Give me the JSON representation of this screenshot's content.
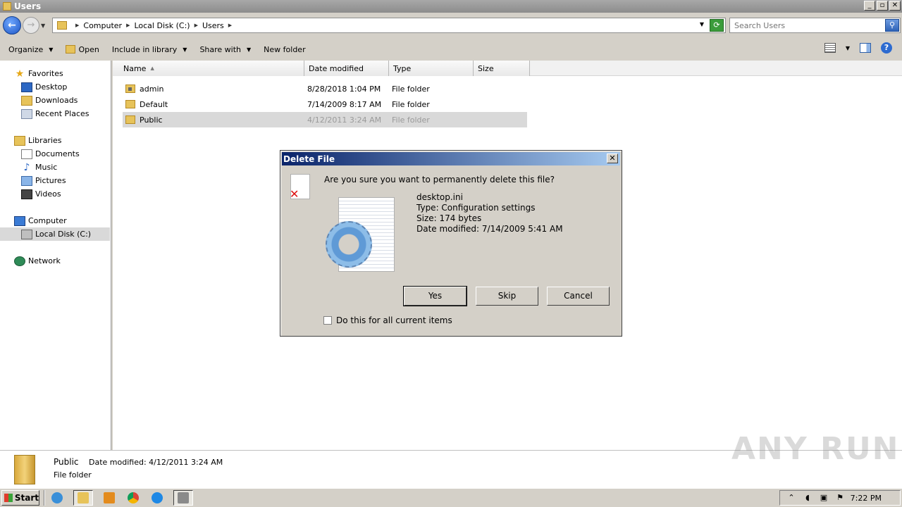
{
  "window": {
    "title": "Users",
    "buttons": {
      "minimize": "_",
      "maximize": "▫",
      "close": "✕"
    }
  },
  "address": {
    "breadcrumbs": [
      "Computer",
      "Local Disk (C:)",
      "Users"
    ],
    "search_placeholder": "Search Users"
  },
  "toolbar": {
    "organize": "Organize",
    "open": "Open",
    "include_in_library": "Include in library",
    "share_with": "Share with",
    "new_folder": "New folder"
  },
  "nav": {
    "favorites": "Favorites",
    "desktop": "Desktop",
    "downloads": "Downloads",
    "recent_places": "Recent Places",
    "libraries": "Libraries",
    "documents": "Documents",
    "music": "Music",
    "pictures": "Pictures",
    "videos": "Videos",
    "computer": "Computer",
    "local_disk": "Local Disk (C:)",
    "network": "Network"
  },
  "columns": {
    "name": "Name",
    "date_modified": "Date modified",
    "type": "Type",
    "size": "Size"
  },
  "files": [
    {
      "name": "admin",
      "date": "8/28/2018 1:04 PM",
      "type": "File folder"
    },
    {
      "name": "Default",
      "date": "7/14/2009 8:17 AM",
      "type": "File folder"
    },
    {
      "name": "Public",
      "date": "4/12/2011 3:24 AM",
      "type": "File folder"
    }
  ],
  "details": {
    "name": "Public",
    "date_modified": "Date modified: 4/12/2011 3:24 AM",
    "type": "File folder"
  },
  "dialog": {
    "title": "Delete File",
    "question": "Are you sure you want to permanently delete this file?",
    "file_name": "desktop.ini",
    "file_type": "Type: Configuration settings",
    "file_size": "Size: 174 bytes",
    "file_date": "Date modified: 7/14/2009 5:41 AM",
    "yes": "Yes",
    "skip": "Skip",
    "cancel": "Cancel",
    "checkbox_label": "Do this for all current items"
  },
  "taskbar": {
    "start": "Start",
    "clock": "7:22 PM"
  },
  "watermark": "ANY RUN"
}
